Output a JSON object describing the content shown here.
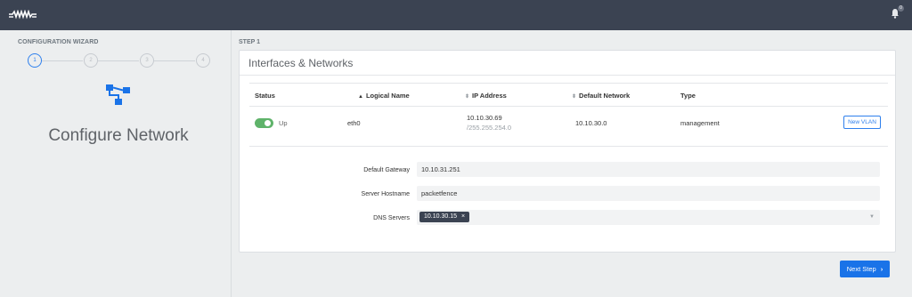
{
  "header": {
    "logo_icon": "packetfence-logo-icon",
    "bell_icon": "bell-icon",
    "notification_count": "0"
  },
  "sidebar": {
    "wizard_title": "CONFIGURATION WIZARD",
    "steps": [
      {
        "number": "1",
        "active": true
      },
      {
        "number": "2",
        "active": false
      },
      {
        "number": "3",
        "active": false
      },
      {
        "number": "4",
        "active": false
      }
    ],
    "section_icon": "network-icon",
    "heading": "Configure Network"
  },
  "main": {
    "step_label": "STEP 1",
    "card_title": "Interfaces & Networks",
    "table": {
      "columns": {
        "status": "Status",
        "logical_name": "Logical Name",
        "ip_address": "IP Address",
        "default_network": "Default Network",
        "type": "Type"
      },
      "rows": [
        {
          "status": "Up",
          "logical_name": "eth0",
          "ip": "10.10.30.69",
          "netmask": "/255.255.254.0",
          "default_network": "10.10.30.0",
          "type": "management",
          "action": "New VLAN"
        }
      ]
    },
    "form": {
      "gateway_label": "Default Gateway",
      "gateway_value": "10.10.31.251",
      "hostname_label": "Server Hostname",
      "hostname_value": "packetfence",
      "dns_label": "DNS Servers",
      "dns_tags": [
        "10.10.30.15"
      ]
    },
    "next_button": "Next Step"
  },
  "colors": {
    "topbar": "#3b4352",
    "accent": "#1a73e8",
    "toggle_on": "#5fb36a"
  }
}
